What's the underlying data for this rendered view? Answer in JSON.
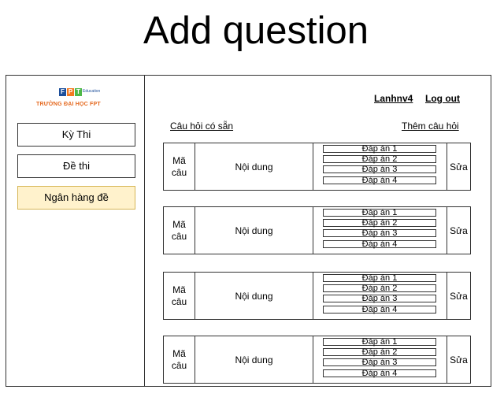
{
  "page_title": "Add question",
  "logo": {
    "letters": [
      "F",
      "P",
      "T"
    ],
    "letter_colors": [
      "#1d4f9b",
      "#f47920",
      "#4eb848"
    ],
    "education": "Education",
    "school": "TRƯỜNG ĐẠI HỌC FPT"
  },
  "sidebar": {
    "items": [
      {
        "label": "Kỳ Thi"
      },
      {
        "label": "Đề thi"
      },
      {
        "label": "Ngân hàng đề"
      }
    ]
  },
  "header": {
    "user": "Lanhnv4",
    "logout": "Log out"
  },
  "bank_link": "Câu hỏi có sẵn",
  "add_link": "Thêm câu hỏi",
  "questions": [
    {
      "id_line1": "Mã",
      "id_line2": "câu",
      "content": "Nội dung",
      "answers": [
        "Đáp án 1",
        "Đáp án 2",
        "Đáp án 3",
        "Đáp án 4"
      ],
      "edit": "Sửa"
    },
    {
      "id_line1": "Mã",
      "id_line2": "câu",
      "content": "Nội dung",
      "answers": [
        "Đáp án 1",
        "Đáp án 2",
        "Đáp án 3",
        "Đáp án 4"
      ],
      "edit": "Sửa"
    },
    {
      "id_line1": "Mã",
      "id_line2": "câu",
      "content": "Nội dung",
      "answers": [
        "Đáp án 1",
        "Đáp án 2",
        "Đáp án 3",
        "Đáp án 4"
      ],
      "edit": "Sửa"
    },
    {
      "id_line1": "Mã",
      "id_line2": "câu",
      "content": "Nội dung",
      "answers": [
        "Đáp án 1",
        "Đáp án 2",
        "Đáp án 3",
        "Đáp án 4"
      ],
      "edit": "Sửa"
    }
  ]
}
